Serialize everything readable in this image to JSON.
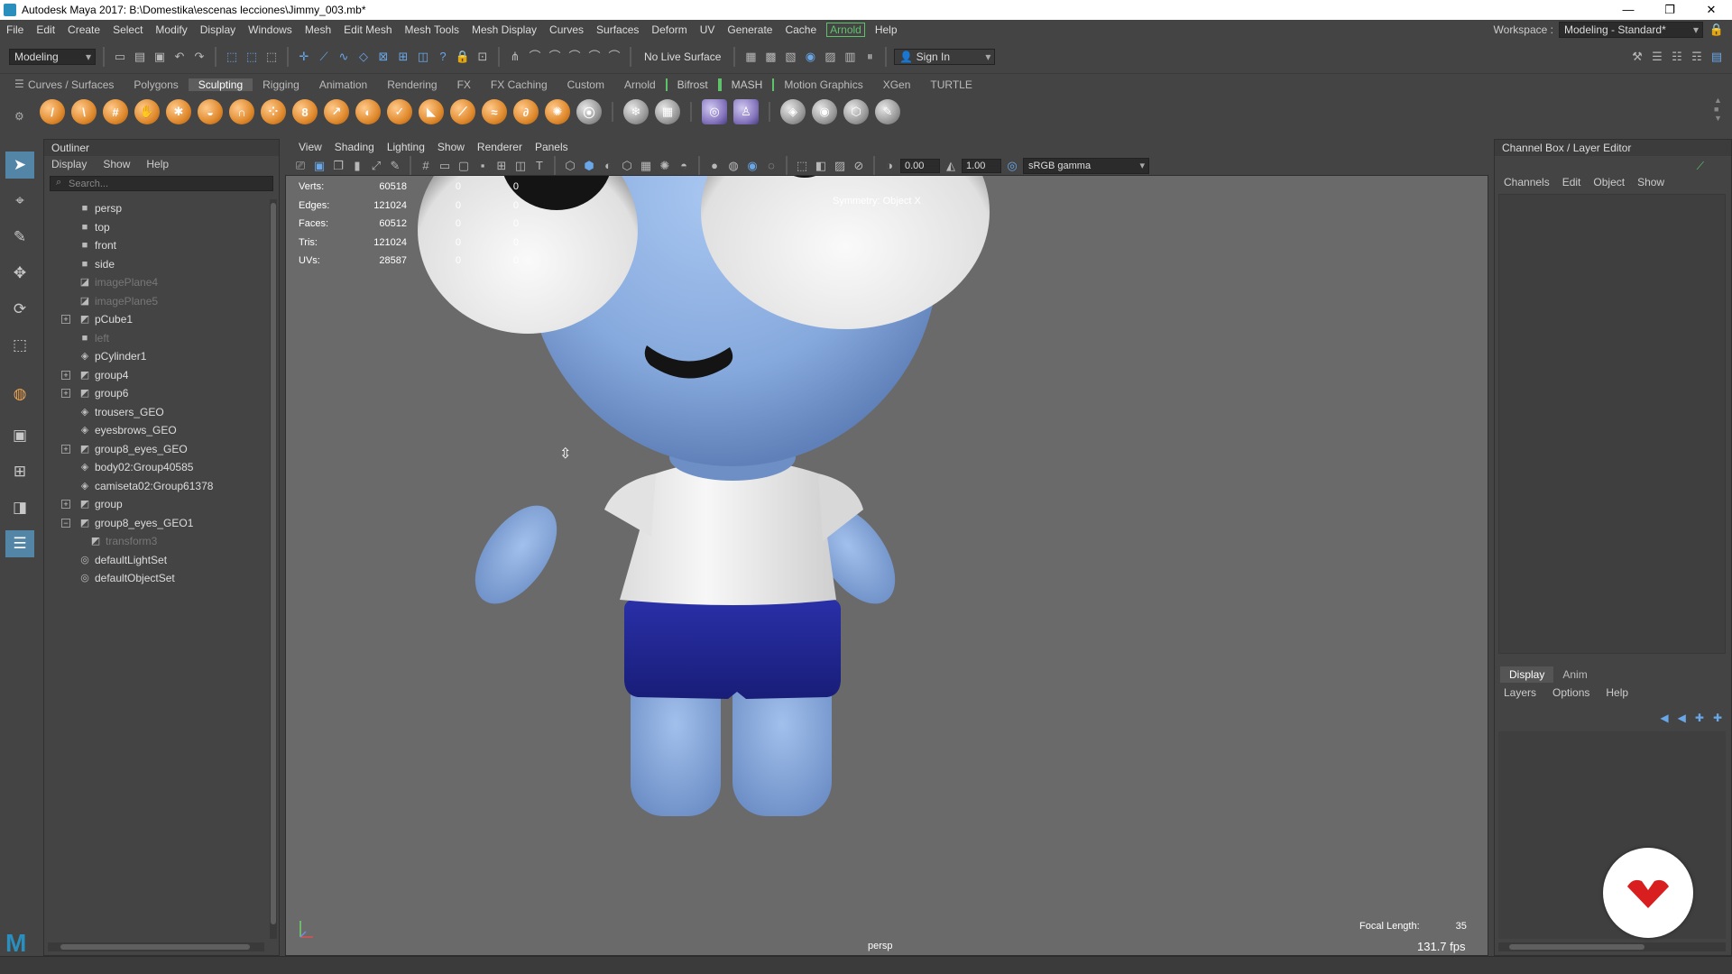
{
  "title_bar": {
    "title": "Autodesk Maya 2017: B:\\Domestika\\escenas lecciones\\Jimmy_003.mb*",
    "minimize": "—",
    "restore": "❐",
    "close": "✕"
  },
  "menu_bar": {
    "items": [
      "File",
      "Edit",
      "Create",
      "Select",
      "Modify",
      "Display",
      "Windows",
      "Mesh",
      "Edit Mesh",
      "Mesh Tools",
      "Mesh Display",
      "Curves",
      "Surfaces",
      "Deform",
      "UV",
      "Generate",
      "Cache"
    ],
    "arnold": "Arnold",
    "help": "Help",
    "workspace_label": "Workspace :",
    "workspace_value": "Modeling - Standard*"
  },
  "status_line": {
    "menuset": "Modeling",
    "live_surface": "No Live Surface",
    "sign_in": "Sign In"
  },
  "shelf_tabs": [
    {
      "label": "Curves / Surfaces",
      "active": false
    },
    {
      "label": "Polygons",
      "active": false
    },
    {
      "label": "Sculpting",
      "active": true
    },
    {
      "label": "Rigging",
      "active": false
    },
    {
      "label": "Animation",
      "active": false
    },
    {
      "label": "Rendering",
      "active": false
    },
    {
      "label": "FX",
      "active": false
    },
    {
      "label": "FX Caching",
      "active": false
    },
    {
      "label": "Custom",
      "active": false
    },
    {
      "label": "Arnold",
      "active": false
    },
    {
      "label": "Bifrost",
      "active": false
    },
    {
      "label": "MASH",
      "active": false
    },
    {
      "label": "Motion Graphics",
      "active": false
    },
    {
      "label": "XGen",
      "active": false
    },
    {
      "label": "TURTLE",
      "active": false
    }
  ],
  "outliner": {
    "title": "Outliner",
    "menus": [
      "Display",
      "Show",
      "Help"
    ],
    "search_placeholder": "Search...",
    "items": [
      {
        "label": "persp",
        "icon": "camera-icon",
        "expand": "",
        "dim": false,
        "indent": false
      },
      {
        "label": "top",
        "icon": "camera-icon",
        "expand": "",
        "dim": false,
        "indent": false
      },
      {
        "label": "front",
        "icon": "camera-icon",
        "expand": "",
        "dim": false,
        "indent": false
      },
      {
        "label": "side",
        "icon": "camera-icon",
        "expand": "",
        "dim": false,
        "indent": false
      },
      {
        "label": "imagePlane4",
        "icon": "imageplane-icon",
        "expand": "",
        "dim": true,
        "indent": false
      },
      {
        "label": "imagePlane5",
        "icon": "imageplane-icon",
        "expand": "",
        "dim": true,
        "indent": false
      },
      {
        "label": "pCube1",
        "icon": "group-icon",
        "expand": "+",
        "dim": false,
        "indent": false
      },
      {
        "label": "left",
        "icon": "camera-icon",
        "expand": "",
        "dim": true,
        "indent": false
      },
      {
        "label": "pCylinder1",
        "icon": "mesh-icon",
        "expand": "",
        "dim": false,
        "indent": false
      },
      {
        "label": "group4",
        "icon": "group-icon",
        "expand": "+",
        "dim": false,
        "indent": false
      },
      {
        "label": "group6",
        "icon": "group-icon",
        "expand": "+",
        "dim": false,
        "indent": false
      },
      {
        "label": "trousers_GEO",
        "icon": "mesh-icon",
        "expand": "",
        "dim": false,
        "indent": false
      },
      {
        "label": "eyesbrows_GEO",
        "icon": "mesh-icon",
        "expand": "",
        "dim": false,
        "indent": false
      },
      {
        "label": "group8_eyes_GEO",
        "icon": "group-icon",
        "expand": "+",
        "dim": false,
        "indent": false
      },
      {
        "label": "body02:Group40585",
        "icon": "mesh-icon",
        "expand": "",
        "dim": false,
        "indent": false
      },
      {
        "label": "camiseta02:Group61378",
        "icon": "mesh-icon",
        "expand": "",
        "dim": false,
        "indent": false
      },
      {
        "label": "group",
        "icon": "group-icon",
        "expand": "+",
        "dim": false,
        "indent": false
      },
      {
        "label": "group8_eyes_GEO1",
        "icon": "group-icon",
        "expand": "−",
        "dim": false,
        "indent": false
      },
      {
        "label": "transform3",
        "icon": "group-icon",
        "expand": "",
        "dim": true,
        "indent": true
      },
      {
        "label": "defaultLightSet",
        "icon": "set-icon",
        "expand": "",
        "dim": false,
        "indent": false
      },
      {
        "label": "defaultObjectSet",
        "icon": "set-icon",
        "expand": "",
        "dim": false,
        "indent": false
      }
    ]
  },
  "viewport_menu": [
    "View",
    "Shading",
    "Lighting",
    "Show",
    "Renderer",
    "Panels"
  ],
  "viewport_toolbar": {
    "exposure": "0.00",
    "gamma": "1.00",
    "color_space": "sRGB gamma"
  },
  "hud": {
    "rows": [
      {
        "label": "Verts:",
        "value": "60518",
        "sel": "0",
        "comp": "0"
      },
      {
        "label": "Edges:",
        "value": "121024",
        "sel": "0",
        "comp": "0"
      },
      {
        "label": "Faces:",
        "value": "60512",
        "sel": "0",
        "comp": "0"
      },
      {
        "label": "Tris:",
        "value": "121024",
        "sel": "0",
        "comp": "0"
      },
      {
        "label": "UVs:",
        "value": "28587",
        "sel": "0",
        "comp": "0"
      }
    ],
    "symmetry": "Symmetry: Object X",
    "focal_label": "Focal Length:",
    "focal_value": "35",
    "fps": "131.7 fps",
    "camera": "persp"
  },
  "channel_box": {
    "title": "Channel Box / Layer Editor",
    "menus": [
      "Channels",
      "Edit",
      "Object",
      "Show"
    ],
    "layer_tabs": [
      {
        "label": "Display",
        "active": true
      },
      {
        "label": "Anim",
        "active": false
      }
    ],
    "layer_menus": [
      "Layers",
      "Options",
      "Help"
    ]
  },
  "colors": {
    "skin": "#8aaee0",
    "shorts": "#22289a",
    "shirt": "#f2f2f2",
    "accent": "#5285a6",
    "arnold_green": "#5fc26b",
    "badge_red": "#d81e1e"
  }
}
